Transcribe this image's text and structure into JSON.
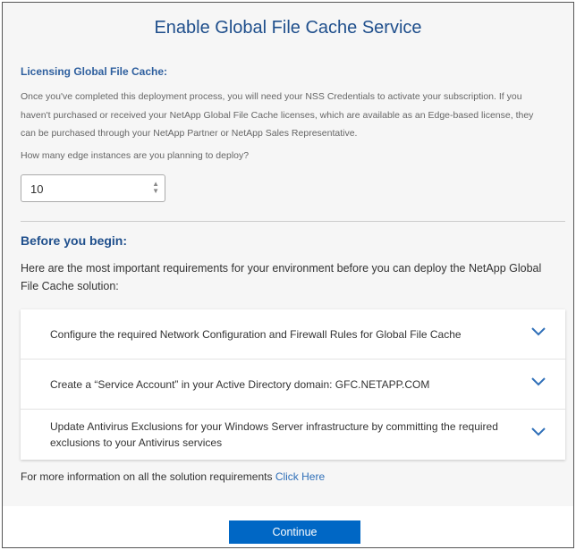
{
  "title": "Enable Global File Cache Service",
  "licensing": {
    "heading": "Licensing Global File Cache:",
    "paragraph": "Once you've completed this deployment process, you will need your NSS Credentials to activate your subscription. If you haven't purchased or received your NetApp Global File Cache licenses, which are available as an Edge-based license, they can be purchased through your NetApp Partner or NetApp Sales Representative.",
    "question": "How many edge instances are you planning to deploy?",
    "edge_instances_value": "10"
  },
  "before_you_begin": {
    "heading": "Before you begin:",
    "paragraph": "Here are the most important requirements for your environment before you can deploy the NetApp Global File Cache solution:",
    "items": [
      {
        "label": "Configure the required Network Configuration and Firewall Rules for Global File Cache",
        "icon": "chevron-down-icon"
      },
      {
        "label": "Create a “Service Account” in your Active Directory domain: GFC.NETAPP.COM",
        "icon": "chevron-down-icon"
      },
      {
        "label": "Update Antivirus Exclusions for your Windows Server infrastructure by committing the required exclusions to your Antivirus services",
        "icon": "chevron-down-icon"
      }
    ],
    "info_text": "For more information on all the solution requirements",
    "info_link": "Click Here"
  },
  "continue_label": "Continue",
  "colors": {
    "accent": "#0067c5",
    "heading": "#1f4f8c"
  }
}
